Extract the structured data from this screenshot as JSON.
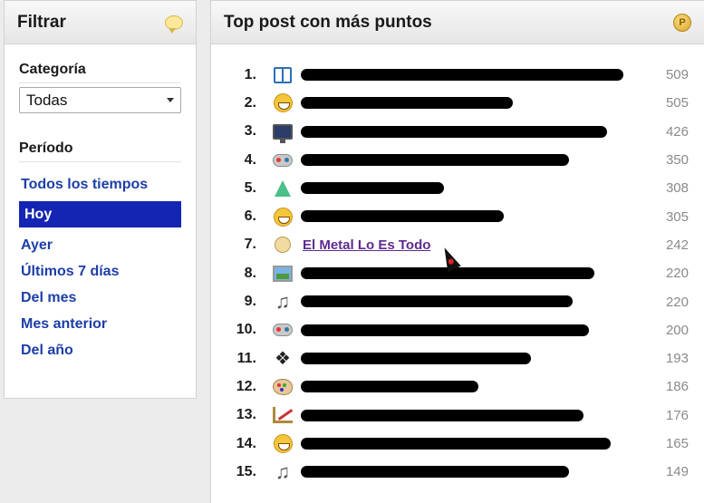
{
  "filter": {
    "title": "Filtrar",
    "category_label": "Categoría",
    "category_value": "Todas",
    "period_label": "Período",
    "periods": [
      {
        "label": "Todos los tiempos",
        "active": false
      },
      {
        "label": "Hoy",
        "active": true
      },
      {
        "label": "Ayer",
        "active": false
      },
      {
        "label": "Últimos 7 días",
        "active": false
      },
      {
        "label": "Del mes",
        "active": false
      },
      {
        "label": "Mes anterior",
        "active": false
      },
      {
        "label": "Del año",
        "active": false
      }
    ],
    "header_icon": "chat-bubble-icon"
  },
  "top": {
    "title": "Top post con más puntos",
    "header_icon": "points-coin-icon",
    "header_icon_glyph": "P",
    "posts": [
      {
        "rank": "1.",
        "icon": "book-icon",
        "title": "",
        "points": "509"
      },
      {
        "rank": "2.",
        "icon": "smiley-icon",
        "title": "",
        "points": "505"
      },
      {
        "rank": "3.",
        "icon": "monitor-icon",
        "title": "",
        "points": "426"
      },
      {
        "rank": "4.",
        "icon": "gamepad-icon",
        "title": "",
        "points": "350"
      },
      {
        "rank": "5.",
        "icon": "flask-icon",
        "title": "",
        "points": "308"
      },
      {
        "rank": "6.",
        "icon": "smiley-icon",
        "title": "",
        "points": "305"
      },
      {
        "rank": "7.",
        "icon": "chat-icon",
        "title": "El Metal Lo Es Todo",
        "points": "242"
      },
      {
        "rank": "8.",
        "icon": "photo-icon",
        "title": "",
        "points": "220"
      },
      {
        "rank": "9.",
        "icon": "music-note-icon",
        "title": "",
        "points": "220"
      },
      {
        "rank": "10.",
        "icon": "gamepad-icon",
        "title": "",
        "points": "200"
      },
      {
        "rank": "11.",
        "icon": "paw-icon",
        "title": "",
        "points": "193"
      },
      {
        "rank": "12.",
        "icon": "palette-icon",
        "title": "",
        "points": "186"
      },
      {
        "rank": "13.",
        "icon": "ruler-icon",
        "title": "",
        "points": "176"
      },
      {
        "rank": "14.",
        "icon": "smiley-icon",
        "title": "",
        "points": "165"
      },
      {
        "rank": "15.",
        "icon": "music-note-icon",
        "title": "",
        "points": "149"
      }
    ]
  },
  "colors": {
    "link": "#1d3ea8",
    "active_bg": "#1525b3",
    "visited": "#5e2b91"
  }
}
